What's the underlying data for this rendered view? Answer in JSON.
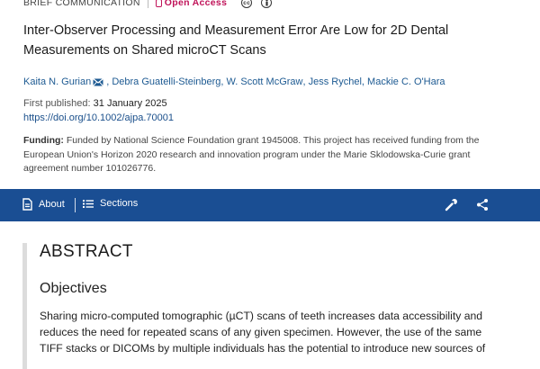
{
  "header": {
    "article_type": "Brief Communication",
    "open_access_label": "Open Access",
    "license_icons": [
      "cc-icon",
      "by-icon"
    ]
  },
  "article": {
    "title": "Inter-Observer Processing and Measurement Error Are Low for 2D Dental Measurements on Shared microCT Scans",
    "authors": [
      "Kaita N. Gurian",
      "Debra Guatelli-Steinberg",
      "W. Scott McGraw",
      "Jess Rychel",
      "Mackie C. O'Hara"
    ],
    "first_published_label": "First published:",
    "first_published_date": "31 January 2025",
    "doi": "https://doi.org/10.1002/ajpa.70001",
    "funding_label": "Funding:",
    "funding_text": "Funded by National Science Foundation grant 1945008. This project has received funding from the European Union's Horizon 2020 research and innovation program under the Marie Sklodowska-Curie grant agreement number 101026776."
  },
  "toolbar": {
    "about_label": "About",
    "sections_label": "Sections",
    "background": "#1a4e93"
  },
  "abstract": {
    "heading": "ABSTRACT",
    "objectives_heading": "Objectives",
    "objectives_text": "Sharing micro-computed tomographic (µCT) scans of teeth increases data accessibility and reduces the need for repeated scans of any given specimen. However, the use of the same TIFF stacks or DICOMs by multiple individuals has the potential to introduce new sources of"
  },
  "colors": {
    "link": "#1d5a92",
    "open_access": "#c0145a"
  }
}
